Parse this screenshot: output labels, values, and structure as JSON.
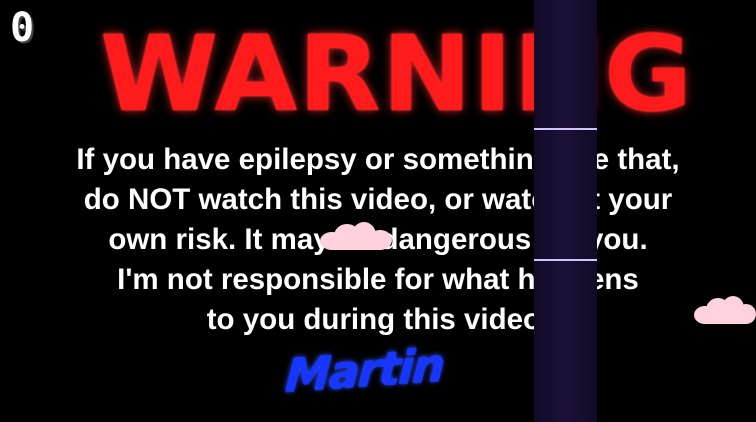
{
  "score": "0",
  "title": "WARNING",
  "message_lines": [
    "If you have epilepsy or something like that,",
    "do NOT watch this video, or watch at your",
    "own risk. It may be dangerous for you.",
    "I'm not responsible for what happens",
    "to you during this video."
  ],
  "signature": "Martin",
  "colors": {
    "background": "#000000",
    "title": "#ff1b1b",
    "message": "#ffffff",
    "signature": "#1736ff",
    "pillar": "#1c1038",
    "cloud": "#ffd2de"
  },
  "sprites": {
    "pillar": "dark-purple-pipe",
    "clouds": [
      "pink-cloud",
      "pink-cloud"
    ]
  }
}
